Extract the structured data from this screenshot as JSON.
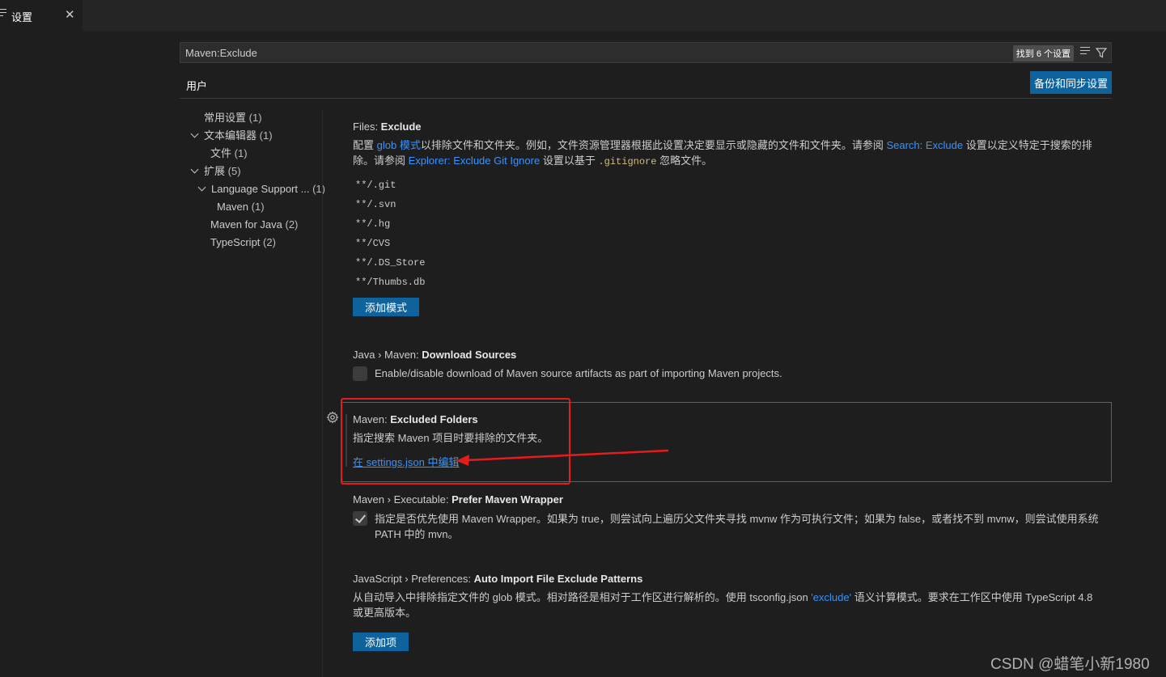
{
  "tab": {
    "label": "设置",
    "close": "✕"
  },
  "search": {
    "value": "Maven:Exclude",
    "count": "找到 6 个设置"
  },
  "scope_tab": "用户",
  "sync_button": "备份和同步设置",
  "toc": [
    {
      "label": "常用设置",
      "count": "(1)"
    },
    {
      "label": "文本编辑器",
      "count": "(1)"
    },
    {
      "label": "文件",
      "count": "(1)"
    },
    {
      "label": "扩展",
      "count": "(5)"
    },
    {
      "label": "Language Support ...",
      "count": "(1)"
    },
    {
      "label": "Maven",
      "count": "(1)"
    },
    {
      "label": "Maven for Java",
      "count": "(2)"
    },
    {
      "label": "TypeScript",
      "count": "(2)"
    }
  ],
  "files_exclude": {
    "category": "Files: ",
    "name": "Exclude",
    "desc_1": "配置 ",
    "desc_link_1": "glob 模式",
    "desc_2": "以排除文件和文件夹。例如，文件资源管理器根据此设置决定要显示或隐藏的文件和文件夹。请参阅 ",
    "desc_link_2": "Search: Exclude",
    "desc_3": " 设置以定义特定于搜索的排除。请参阅 ",
    "desc_link_3": "Explorer: Exclude Git Ignore",
    "desc_4": " 设置以基于 ",
    "desc_code": ".gitignore",
    "desc_5": " 忽略文件。",
    "patterns": [
      "**/.git",
      "**/.svn",
      "**/.hg",
      "**/CVS",
      "**/.DS_Store",
      "**/Thumbs.db"
    ],
    "add_button": "添加模式"
  },
  "download_sources": {
    "category": "Java › Maven: ",
    "name": "Download Sources",
    "desc": "Enable/disable download of Maven source artifacts as part of importing Maven projects.",
    "checked": false
  },
  "excluded_folders": {
    "category": "Maven: ",
    "name": "Excluded Folders",
    "desc": "指定搜索 Maven 项目时要排除的文件夹。",
    "link": "在 settings.json 中编辑"
  },
  "prefer_wrapper": {
    "category": "Maven › Executable: ",
    "name": "Prefer Maven Wrapper",
    "desc": "指定是否优先使用 Maven Wrapper。如果为 true，则尝试向上遍历父文件夹寻找 mvnw 作为可执行文件；如果为 false，或者找不到 mvnw，则尝试使用系统 PATH 中的 mvn。",
    "checked": true
  },
  "auto_import": {
    "category": "JavaScript › Preferences: ",
    "name": "Auto Import File Exclude Patterns",
    "desc_1": "从自动导入中排除指定文件的 glob 模式。相对路径是相对于工作区进行解析的。使用 tsconfig.json ",
    "desc_link": "'exclude'",
    "desc_2": " 语义计算模式。要求在工作区中使用 TypeScript 4.8 或更高版本。",
    "add_button": "添加项"
  },
  "watermark": "CSDN @蜡笔小新1980",
  "colors": {
    "accent": "#0e639c",
    "link": "#3794ff",
    "annotation": "#e81b1b",
    "focus": "#007acc"
  }
}
